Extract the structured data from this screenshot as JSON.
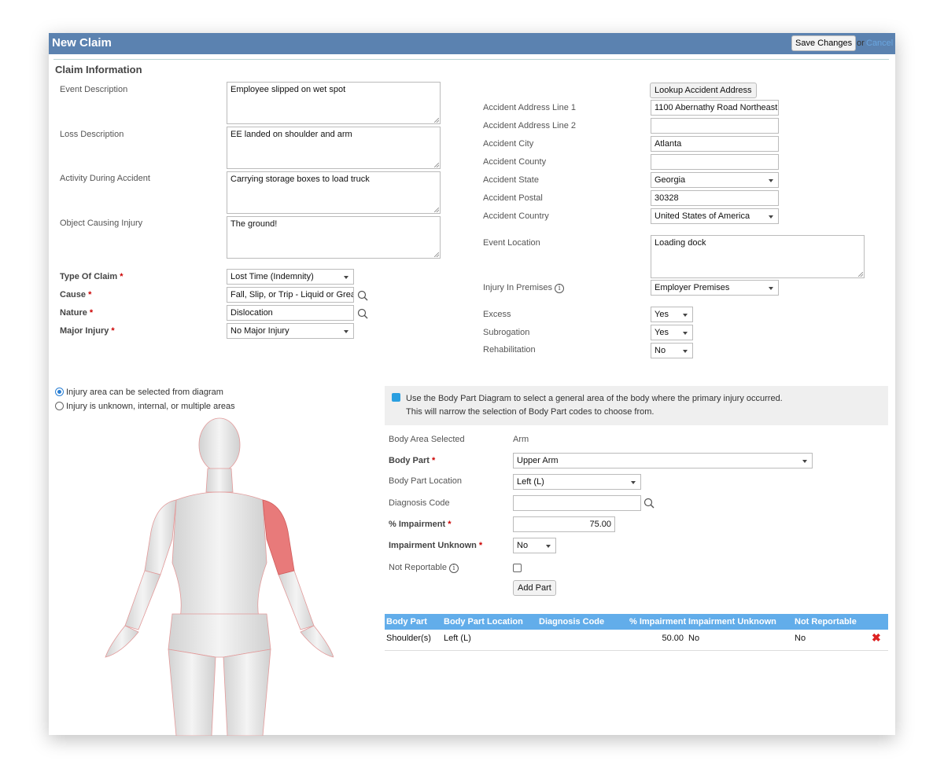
{
  "header": {
    "title": "New Claim",
    "save_label": "Save Changes",
    "or": "or",
    "cancel_label": "Cancel"
  },
  "section_title": "Claim Information",
  "left_fields": {
    "event_description": {
      "label": "Event Description",
      "value": "Employee slipped on wet spot"
    },
    "loss_description": {
      "label": "Loss Description",
      "value": "EE landed on shoulder and arm"
    },
    "activity": {
      "label": "Activity During Accident",
      "value": "Carrying storage boxes to load truck"
    },
    "object": {
      "label": "Object Causing Injury",
      "value": "The ground!"
    },
    "type_of_claim": {
      "label": "Type Of Claim",
      "value": "Lost Time (Indemnity)"
    },
    "cause": {
      "label": "Cause",
      "value": "Fall, Slip, or Trip - Liquid or Grease"
    },
    "nature": {
      "label": "Nature",
      "value": "Dislocation"
    },
    "major_injury": {
      "label": "Major Injury",
      "value": "No Major Injury"
    }
  },
  "right_fields": {
    "lookup_label": "Lookup Accident Address",
    "address1": {
      "label": "Accident Address Line 1",
      "value": "1100 Abernathy Road Northeast"
    },
    "address2": {
      "label": "Accident Address Line 2",
      "value": ""
    },
    "city": {
      "label": "Accident City",
      "value": "Atlanta"
    },
    "county": {
      "label": "Accident County",
      "value": ""
    },
    "state": {
      "label": "Accident State",
      "value": "Georgia"
    },
    "postal": {
      "label": "Accident Postal",
      "value": "30328"
    },
    "country": {
      "label": "Accident Country",
      "value": "United States of America"
    },
    "event_location": {
      "label": "Event Location",
      "value": "Loading dock"
    },
    "premises": {
      "label": "Injury In Premises",
      "value": "Employer Premises"
    },
    "excess": {
      "label": "Excess",
      "value": "Yes"
    },
    "subrogation": {
      "label": "Subrogation",
      "value": "Yes"
    },
    "rehabilitation": {
      "label": "Rehabilitation",
      "value": "No"
    }
  },
  "injury_mode": {
    "options": [
      "Injury area can be selected from diagram",
      "Injury is unknown, internal, or multiple areas"
    ],
    "selected": 0
  },
  "info": {
    "line1": "Use the Body Part Diagram to select a general area of the body where the primary injury occurred.",
    "line2": "This will narrow the selection of Body Part codes to choose from."
  },
  "body": {
    "area": {
      "label": "Body Area Selected",
      "value": "Arm"
    },
    "part": {
      "label": "Body Part",
      "value": "Upper Arm"
    },
    "location": {
      "label": "Body Part Location",
      "value": "Left (L)"
    },
    "diagnosis": {
      "label": "Diagnosis Code",
      "value": ""
    },
    "impairment": {
      "label": "% Impairment",
      "value": "75.00"
    },
    "unknown": {
      "label": "Impairment Unknown",
      "value": "No"
    },
    "not_reportable": {
      "label": "Not Reportable",
      "checked": false
    },
    "add_label": "Add Part"
  },
  "table": {
    "headers": [
      "Body Part",
      "Body Part Location",
      "Diagnosis Code",
      "% Impairment",
      "Impairment Unknown",
      "Not Reportable"
    ],
    "rows": [
      {
        "part": "Shoulder(s)",
        "location": "Left (L)",
        "diagnosis": "",
        "impairment": "50.00",
        "unknown": "No",
        "not_reportable": "No"
      }
    ]
  },
  "colors": {
    "header": "#5b82b0",
    "table_header": "#62adea",
    "highlight": "#e87a7a"
  }
}
